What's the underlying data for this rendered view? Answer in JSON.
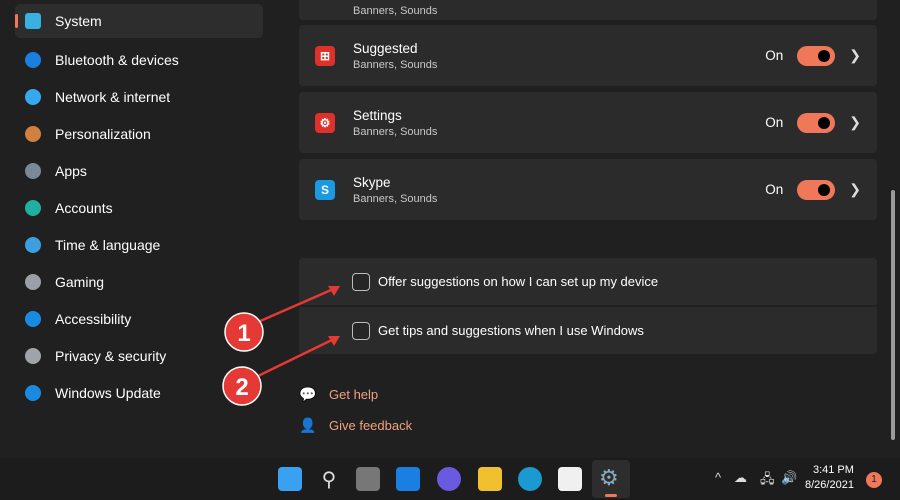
{
  "sidebar": {
    "items": [
      {
        "label": "System",
        "icon": "monitor-icon",
        "color": "#3ab0e0"
      },
      {
        "label": "Bluetooth & devices",
        "icon": "bluetooth-icon",
        "color": "#1a7fe0"
      },
      {
        "label": "Network & internet",
        "icon": "wifi-icon",
        "color": "#35a8f0"
      },
      {
        "label": "Personalization",
        "icon": "brush-icon",
        "color": "#d08040"
      },
      {
        "label": "Apps",
        "icon": "apps-icon",
        "color": "#7a8898"
      },
      {
        "label": "Accounts",
        "icon": "person-icon",
        "color": "#20b0a0"
      },
      {
        "label": "Time & language",
        "icon": "globe-clock-icon",
        "color": "#3ba0e0"
      },
      {
        "label": "Gaming",
        "icon": "gamepad-icon",
        "color": "#9aa0a8"
      },
      {
        "label": "Accessibility",
        "icon": "accessibility-icon",
        "color": "#1a8ae0"
      },
      {
        "label": "Privacy & security",
        "icon": "shield-icon",
        "color": "#a0a4a8"
      },
      {
        "label": "Windows Update",
        "icon": "update-icon",
        "color": "#1a8ae0"
      }
    ]
  },
  "top_card_sub": "Banners, Sounds",
  "apps": [
    {
      "name": "Suggested",
      "sub": "Banners, Sounds",
      "state": "On",
      "on": true,
      "icon": "suggested-icon",
      "color": "#e0302a",
      "glyph": "⊞"
    },
    {
      "name": "Settings",
      "sub": "Banners, Sounds",
      "state": "On",
      "on": true,
      "icon": "settings-gear-icon",
      "color": "#e0302a",
      "glyph": "⚙"
    },
    {
      "name": "Skype",
      "sub": "Banners, Sounds",
      "state": "On",
      "on": true,
      "icon": "skype-icon",
      "color": "#1a9ae0",
      "glyph": "S"
    }
  ],
  "options": [
    {
      "label": "Offer suggestions on how I can set up my device",
      "checked": false
    },
    {
      "label": "Get tips and suggestions when I use Windows",
      "checked": false
    }
  ],
  "links": {
    "help": "Get help",
    "feedback": "Give feedback"
  },
  "annotations": [
    "1",
    "2"
  ],
  "taskbar": {
    "time": "3:41 PM",
    "date": "8/26/2021",
    "badge": "1",
    "tray": [
      "^",
      "☁",
      "🖧",
      "🔊"
    ]
  },
  "accent": "#f0785a"
}
